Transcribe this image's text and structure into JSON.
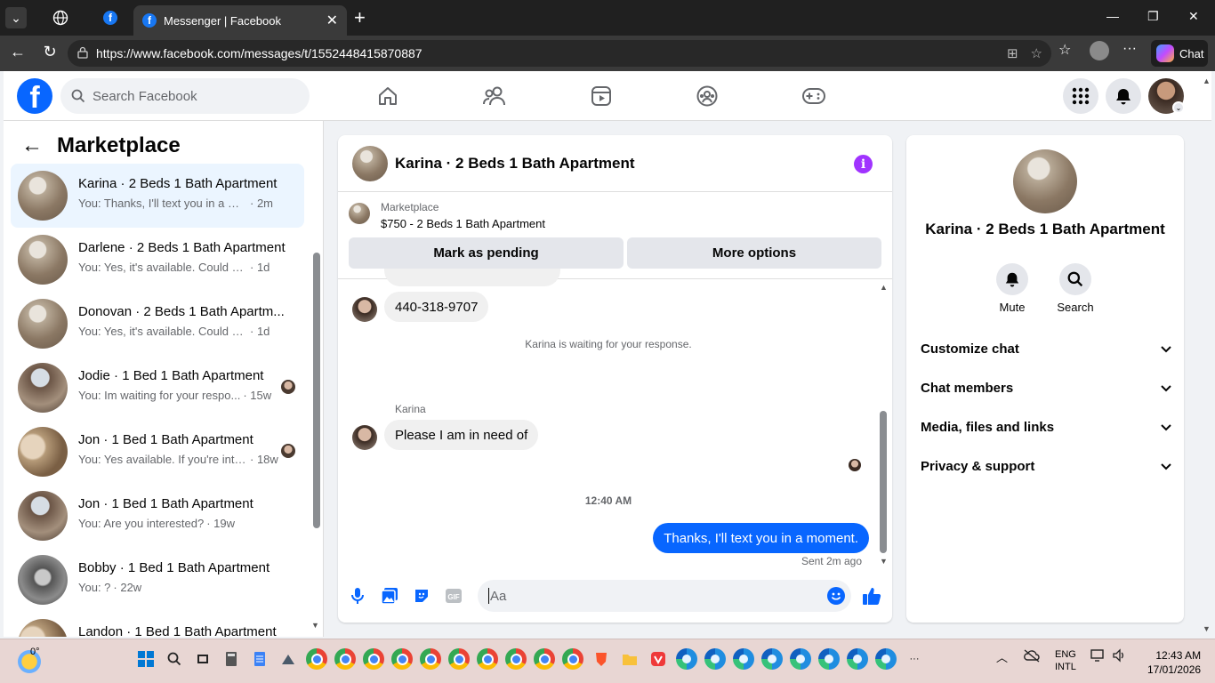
{
  "browser": {
    "tab_title": "Messenger | Facebook",
    "url": "https://www.facebook.com/messages/t/1552448415870887",
    "chat_label": "Chat"
  },
  "fb": {
    "search_placeholder": "Search Facebook"
  },
  "sidebar": {
    "title": "Marketplace",
    "conversations": [
      {
        "name": "Karina · 2 Beds 1 Bath Apartment",
        "preview": "You: Thanks, I'll text you in a mom...",
        "time": "· 2m",
        "active": true
      },
      {
        "name": "Darlene · 2 Beds 1 Bath Apartment",
        "preview": "You: Yes, it's available. Could you pl...",
        "time": "· 1d"
      },
      {
        "name": "Donovan · 2 Beds 1 Bath Apartm...",
        "preview": "You: Yes, it's available. Could you pl...",
        "time": "· 1d"
      },
      {
        "name": "Jodie · 1 Bed 1 Bath Apartment",
        "preview": "You: Im waiting for your respo...",
        "time": "· 15w"
      },
      {
        "name": "Jon · 1 Bed 1 Bath Apartment",
        "preview": "You: Yes available. If you're inte...",
        "time": "· 18w"
      },
      {
        "name": "Jon · 1 Bed 1 Bath Apartment",
        "preview": "You: Are you interested?",
        "time": "· 19w"
      },
      {
        "name": "Bobby · 1 Bed 1 Bath Apartment",
        "preview": "You: ?",
        "time": "· 22w"
      },
      {
        "name": "Landon · 1 Bed 1 Bath Apartment",
        "preview": "",
        "time": ""
      }
    ]
  },
  "chat": {
    "title": "Karina · 2 Beds 1 Bath Apartment",
    "listing_category": "Marketplace",
    "listing_price_title": "$750 - 2 Beds 1 Bath Apartment",
    "mark_pending": "Mark as pending",
    "more_options": "More options",
    "msg_phone": "440-318-9707",
    "waiting_text": "Karina is waiting for your response.",
    "sender": "Karina",
    "msg_incoming": "Please I am in need of",
    "timestamp": "12:40 AM",
    "msg_outgoing": "Thanks, I'll text you in a moment.",
    "sent_status": "Sent 2m ago",
    "composer_placeholder": "Aa"
  },
  "details": {
    "name": "Karina · 2 Beds 1 Bath Apartment",
    "mute_label": "Mute",
    "search_label": "Search",
    "sections": [
      "Customize chat",
      "Chat members",
      "Media, files and links",
      "Privacy & support"
    ]
  },
  "taskbar": {
    "temperature": "0°",
    "lang_top": "ENG",
    "lang_bottom": "INTL",
    "time": "12:43 AM",
    "date": "17/01/2026"
  },
  "colors": {
    "fb_blue": "#0866ff",
    "outgoing_bubble": "#0866ff",
    "info_purple": "#a033ff"
  }
}
